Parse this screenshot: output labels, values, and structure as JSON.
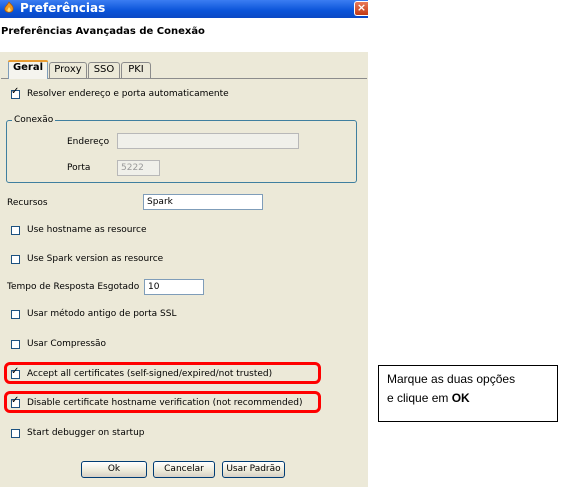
{
  "window": {
    "title": "Preferências",
    "close_label": "×"
  },
  "header": {
    "title": "Preferências Avançadas de Conexão"
  },
  "tabs": [
    {
      "label": "Geral",
      "active": true
    },
    {
      "label": "Proxy",
      "active": false
    },
    {
      "label": "SSO",
      "active": false
    },
    {
      "label": "PKI",
      "active": false
    }
  ],
  "auto_resolve": {
    "label": "Resolver endereço e porta automaticamente",
    "checked": true
  },
  "connection": {
    "group_title": "Conexão",
    "address_label": "Endereço",
    "address_value": "",
    "port_label": "Porta",
    "port_value": "5222"
  },
  "resource": {
    "label": "Recursos",
    "value": "Spark"
  },
  "use_hostname": {
    "label": "Use hostname as resource",
    "checked": false
  },
  "use_spark_version": {
    "label": "Use Spark version as resource",
    "checked": false
  },
  "timeout": {
    "label": "Tempo de Resposta Esgotado",
    "value": "10"
  },
  "old_ssl": {
    "label": "Usar método antigo de porta SSL",
    "checked": false
  },
  "compression": {
    "label": "Usar Compressão",
    "checked": false
  },
  "accept_certs": {
    "label": "Accept all certificates (self-signed/expired/not trusted)",
    "checked": true
  },
  "disable_hostname_verif": {
    "label": "Disable certificate hostname verification (not recommended)",
    "checked": true
  },
  "debugger": {
    "label": "Start debugger on startup",
    "checked": false
  },
  "buttons": {
    "ok": "Ok",
    "cancel": "Cancelar",
    "defaults": "Usar Padrão"
  },
  "annotation": {
    "line1": "Marque as duas opções",
    "line2_prefix": "e clique em ",
    "line2_bold": "OK"
  },
  "colors": {
    "highlight": "#ff0000",
    "titlebar": "#0a53d8",
    "dialog_bg": "#ece9d8"
  }
}
